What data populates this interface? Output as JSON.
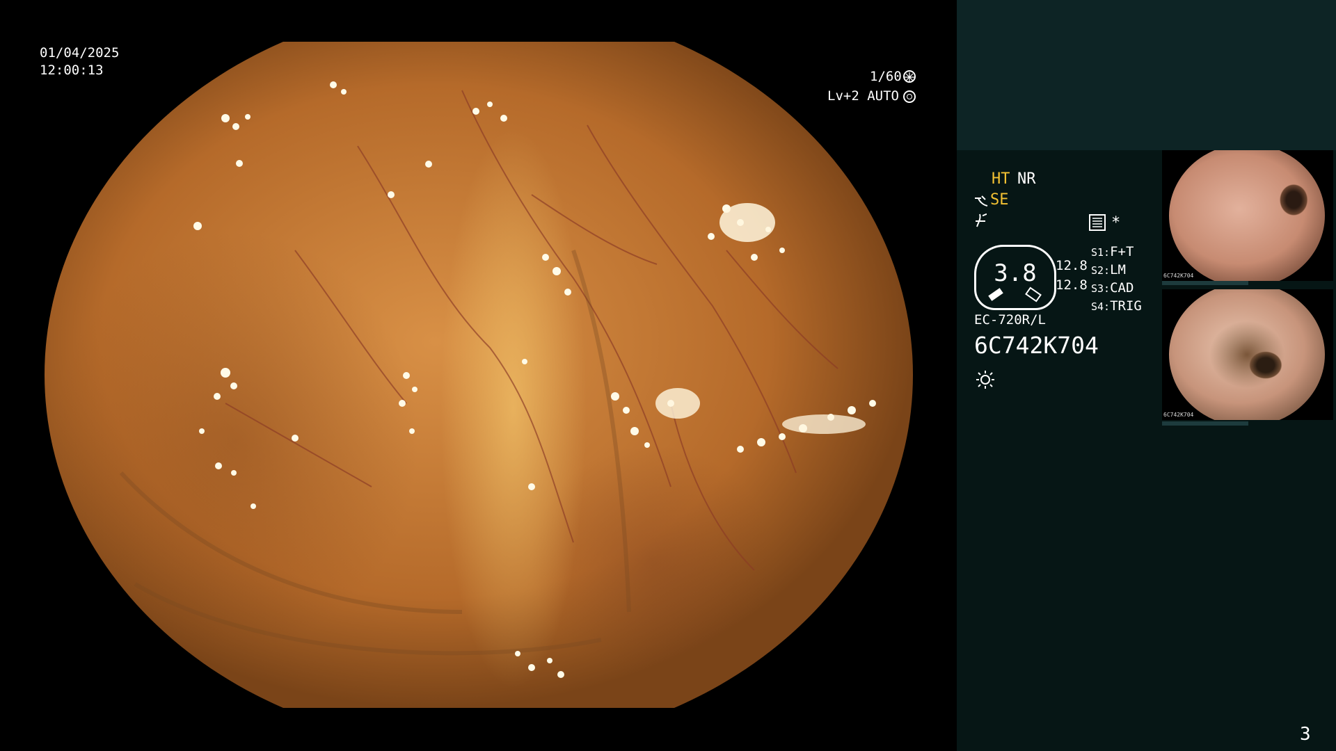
{
  "osd": {
    "date": "01/04/2025",
    "time": "12:00:13",
    "shutter": "1/60",
    "shutter_icon": "aperture-icon",
    "iris": "Lv+2 AUTO",
    "iris_icon": "iris-icon"
  },
  "panel": {
    "mode_left": "HT",
    "mode_right": "NR",
    "enhance_label": "SE",
    "enhance_icon": "zoom-curve-icon",
    "structure_icon": "structure-icon",
    "record_icon": "record-icon",
    "asterisk": "*",
    "gauge_value": "3.8",
    "readout_1": "12.8",
    "readout_2": "12.8",
    "switches": [
      {
        "id": "S1:",
        "value": "F+T"
      },
      {
        "id": "S2:",
        "value": "LM"
      },
      {
        "id": "S3:",
        "value": "CAD"
      },
      {
        "id": "S4:",
        "value": "TRIG"
      }
    ],
    "scope_model": "EC-720R/L",
    "serial": "6C742K704",
    "light_icon": "light-icon",
    "page_number": "3"
  },
  "thumbnails": [
    {
      "name": "thumb-1",
      "caption": "6C742K704"
    },
    {
      "name": "thumb-2",
      "caption": "6C742K704"
    }
  ],
  "colors": {
    "panel_bg": "#061615",
    "panel_top": "#0d2425",
    "accent_yellow": "#f4c233"
  }
}
